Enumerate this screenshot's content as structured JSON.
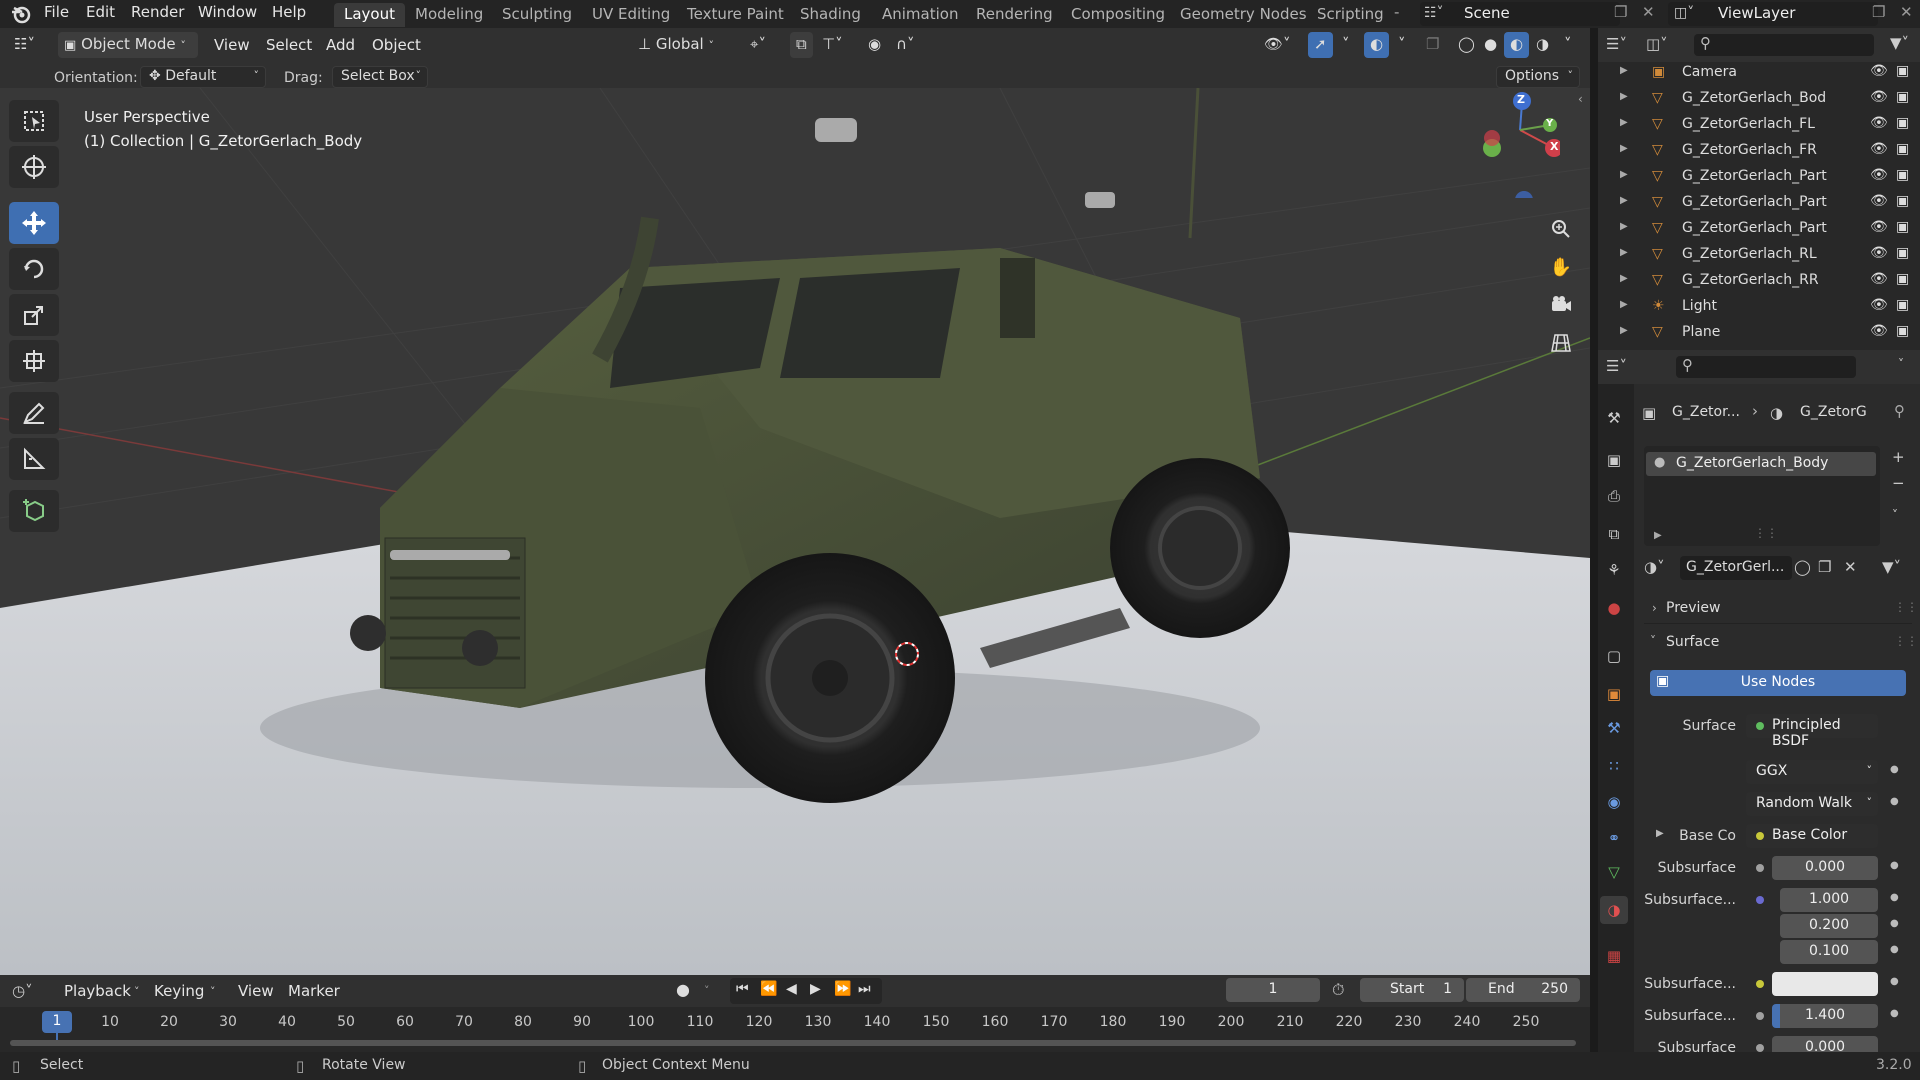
{
  "topbar": {
    "menus": [
      "File",
      "Edit",
      "Render",
      "Window",
      "Help"
    ],
    "workspaces": [
      "Layout",
      "Modeling",
      "Sculpting",
      "UV Editing",
      "Texture Paint",
      "Shading",
      "Animation",
      "Rendering",
      "Compositing",
      "Geometry Nodes",
      "Scripting"
    ],
    "active_workspace": "Layout",
    "scene": "Scene",
    "view_layer": "ViewLayer"
  },
  "viewport_header": {
    "mode": "Object Mode",
    "menus": [
      "View",
      "Select",
      "Add",
      "Object"
    ],
    "transform_orientation": "Global",
    "orientation_label": "Orientation:",
    "orientation_value": "Default",
    "drag_label": "Drag:",
    "drag_value": "Select Box",
    "options": "Options"
  },
  "viewport": {
    "view_name": "User Perspective",
    "collection_info": "(1) Collection | G_ZetorGerlach_Body",
    "gizmo_axes": [
      "Z",
      "Y",
      "X"
    ]
  },
  "outliner": {
    "items": [
      {
        "name": "Camera",
        "icon": "camera-icon"
      },
      {
        "name": "G_ZetorGerlach_Bod",
        "icon": "mesh-icon"
      },
      {
        "name": "G_ZetorGerlach_FL",
        "icon": "mesh-icon"
      },
      {
        "name": "G_ZetorGerlach_FR",
        "icon": "mesh-icon"
      },
      {
        "name": "G_ZetorGerlach_Part",
        "icon": "mesh-icon"
      },
      {
        "name": "G_ZetorGerlach_Part",
        "icon": "mesh-icon"
      },
      {
        "name": "G_ZetorGerlach_Part",
        "icon": "mesh-icon"
      },
      {
        "name": "G_ZetorGerlach_RL",
        "icon": "mesh-icon"
      },
      {
        "name": "G_ZetorGerlach_RR",
        "icon": "mesh-icon"
      },
      {
        "name": "Light",
        "icon": "light-icon"
      },
      {
        "name": "Plane",
        "icon": "mesh-icon"
      }
    ]
  },
  "properties": {
    "breadcrumb_object": "G_Zetor...",
    "breadcrumb_material": "G_ZetorG",
    "material_slot": "G_ZetorGerlach_Body",
    "material_name": "G_ZetorGerl...",
    "panels": {
      "preview": "Preview",
      "surface": "Surface"
    },
    "use_nodes": "Use Nodes",
    "surface_label": "Surface",
    "surface_value": "Principled BSDF",
    "distribution": "GGX",
    "subsurface_method": "Random Walk",
    "base_color_label": "Base Co",
    "base_color_value": "Base Color",
    "subsurface_label": "Subsurface",
    "subsurface_value": "0.000",
    "subsurface_radius_label": "Subsurface...",
    "subsurface_radius": [
      "1.000",
      "0.200",
      "0.100"
    ],
    "subsurface_color_label": "Subsurface...",
    "subsurface_ior_label": "Subsurface...",
    "subsurface_ior": "1.400",
    "subsurface_aniso_label": "Subsurface",
    "subsurface_aniso": "0.000",
    "color_swatch": "#e8e8e8"
  },
  "timeline": {
    "menus": [
      "Playback",
      "Keying",
      "View",
      "Marker"
    ],
    "current_frame": "1",
    "start_label": "Start",
    "start": "1",
    "end_label": "End",
    "end": "250",
    "ticks": [
      "10",
      "20",
      "30",
      "40",
      "50",
      "60",
      "70",
      "80",
      "90",
      "100",
      "110",
      "120",
      "130",
      "140",
      "150",
      "160",
      "170",
      "180",
      "190",
      "200",
      "210",
      "220",
      "230",
      "240",
      "250"
    ],
    "playhead": "1"
  },
  "statusbar": {
    "select": "Select",
    "rotate": "Rotate View",
    "context": "Object Context Menu",
    "version": "3.2.0"
  },
  "colors": {
    "accent": "#4772b3",
    "vehicle": "#4a5038",
    "floor": "#c8cbd0"
  }
}
